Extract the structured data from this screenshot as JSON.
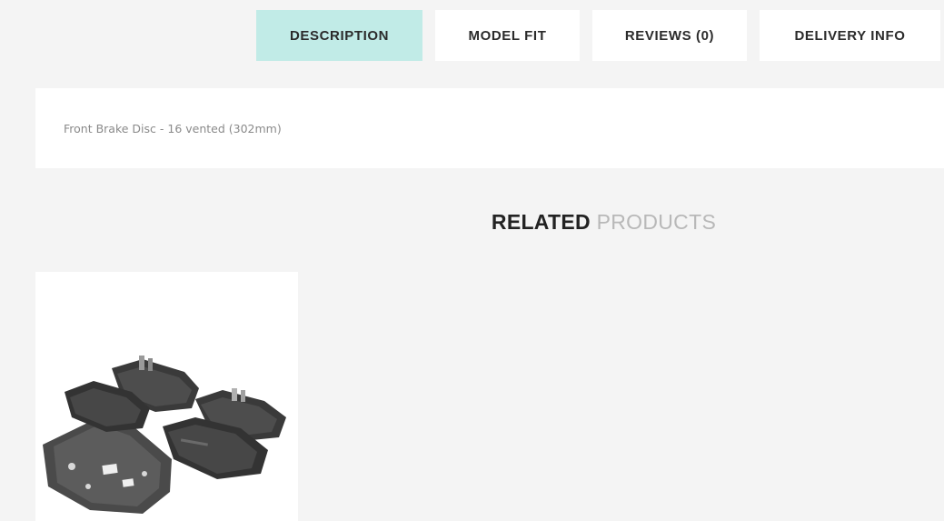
{
  "tabs": [
    {
      "label": "DESCRIPTION",
      "active": true
    },
    {
      "label": "MODEL FIT",
      "active": false
    },
    {
      "label": "REVIEWS (0)",
      "active": false
    },
    {
      "label": "DELIVERY INFO",
      "active": false
    }
  ],
  "description": {
    "text": "Front Brake Disc - 16 vented (302mm)"
  },
  "related": {
    "heading_strong": "RELATED",
    "heading_light": "PRODUCTS"
  },
  "product": {
    "image": "brake-pads-set"
  },
  "colors": {
    "active_tab": "#c1ebe7",
    "background": "#f4f4f4",
    "panel": "#ffffff"
  }
}
